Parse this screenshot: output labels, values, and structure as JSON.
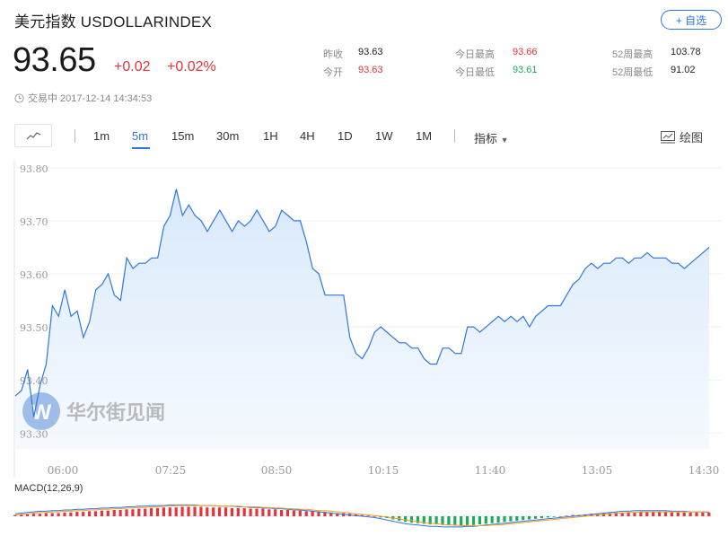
{
  "header": {
    "title": "美元指数 USDOLLARINDEX",
    "follow_label": "+ 自选",
    "price": "93.65",
    "change": "+0.02",
    "change_pct": "+0.02%",
    "status": "交易中 2017-12-14 14:34:53"
  },
  "stats": {
    "prev_close_label": "昨收",
    "prev_close": "93.63",
    "open_label": "今开",
    "open": "93.63",
    "high_label": "今日最高",
    "high": "93.66",
    "low_label": "今日最低",
    "low": "93.61",
    "w52_high_label": "52周最高",
    "w52_high": "103.78",
    "w52_low_label": "52周最低",
    "w52_low": "91.02"
  },
  "toolbar": {
    "intervals": [
      "1m",
      "5m",
      "15m",
      "30m",
      "1H",
      "4H",
      "1D",
      "1W",
      "1M"
    ],
    "active_interval": "5m",
    "indicator_label": "指标",
    "draw_label": "绘图"
  },
  "watermark": {
    "text": "华尔街见闻"
  },
  "colors": {
    "up": "#e8333a",
    "down": "#1bab5b",
    "line": "#2f76e0",
    "accent": "#2f76e0"
  },
  "chart_data": {
    "type": "area",
    "x_ticks": [
      "06:00",
      "07:25",
      "08:50",
      "10:15",
      "11:40",
      "13:05",
      "14:30"
    ],
    "y_ticks": [
      "93.80",
      "93.70",
      "93.60",
      "93.50",
      "93.40",
      "93.30"
    ],
    "ylim": [
      93.27,
      93.815
    ],
    "x": [
      "05:17",
      "05:22",
      "05:27",
      "05:32",
      "05:37",
      "05:42",
      "05:47",
      "05:52",
      "05:57",
      "06:02",
      "06:07",
      "06:12",
      "06:17",
      "06:22",
      "06:27",
      "06:32",
      "06:37",
      "06:42",
      "06:47",
      "06:52",
      "06:57",
      "07:02",
      "07:07",
      "07:12",
      "07:17",
      "07:22",
      "07:27",
      "07:32",
      "07:37",
      "07:42",
      "07:47",
      "07:52",
      "07:57",
      "08:02",
      "08:07",
      "08:12",
      "08:17",
      "08:22",
      "08:27",
      "08:32",
      "08:37",
      "08:42",
      "08:47",
      "08:52",
      "08:57",
      "09:02",
      "09:07",
      "09:12",
      "09:17",
      "09:22",
      "09:27",
      "09:32",
      "09:37",
      "09:42",
      "09:47",
      "09:52",
      "09:57",
      "10:02",
      "10:07",
      "10:12",
      "10:17",
      "10:22",
      "10:27",
      "10:32",
      "10:37",
      "10:42",
      "10:47",
      "10:52",
      "10:57",
      "11:02",
      "11:07",
      "11:12",
      "11:17",
      "11:22",
      "11:27",
      "11:32",
      "11:37",
      "11:42",
      "11:47",
      "11:52",
      "11:57",
      "12:02",
      "12:07",
      "12:12",
      "12:17",
      "12:22",
      "12:27",
      "12:32",
      "12:37",
      "12:42",
      "12:47",
      "12:52",
      "12:57",
      "13:02",
      "13:07",
      "13:12",
      "13:17",
      "13:22",
      "13:27",
      "13:32",
      "13:37",
      "13:42",
      "13:47",
      "13:52",
      "13:57",
      "14:02",
      "14:07",
      "14:12",
      "14:17",
      "14:22",
      "14:27",
      "14:32",
      "14:37"
    ],
    "values": [
      93.37,
      93.38,
      93.42,
      93.33,
      93.39,
      93.43,
      93.54,
      93.52,
      93.57,
      93.52,
      93.53,
      93.48,
      93.51,
      93.57,
      93.58,
      93.6,
      93.56,
      93.55,
      93.63,
      93.61,
      93.62,
      93.62,
      93.63,
      93.63,
      93.69,
      93.71,
      93.76,
      93.71,
      93.73,
      93.71,
      93.7,
      93.68,
      93.7,
      93.72,
      93.7,
      93.68,
      93.7,
      93.69,
      93.7,
      93.72,
      93.7,
      93.68,
      93.69,
      93.72,
      93.71,
      93.7,
      93.7,
      93.66,
      93.61,
      93.6,
      93.56,
      93.56,
      93.56,
      93.56,
      93.48,
      93.45,
      93.44,
      93.46,
      93.49,
      93.5,
      93.49,
      93.48,
      93.47,
      93.47,
      93.46,
      93.46,
      93.44,
      93.43,
      93.43,
      93.46,
      93.46,
      93.45,
      93.45,
      93.5,
      93.5,
      93.49,
      93.5,
      93.51,
      93.52,
      93.51,
      93.52,
      93.51,
      93.52,
      93.5,
      93.52,
      93.53,
      93.54,
      93.54,
      93.54,
      93.56,
      93.58,
      93.59,
      93.61,
      93.62,
      93.61,
      93.62,
      93.62,
      93.63,
      93.63,
      93.62,
      93.63,
      93.63,
      93.64,
      93.63,
      93.63,
      93.63,
      93.62,
      93.62,
      93.61,
      93.62,
      93.63,
      93.64,
      93.65
    ],
    "macd": {
      "label": "MACD(12,26,9)",
      "histogram": [
        0.02,
        0.03,
        0.03,
        0.04,
        0.04,
        0.05,
        0.05,
        0.05,
        0.06,
        0.06,
        0.07,
        0.07,
        0.08,
        0.08,
        0.09,
        0.09,
        0.1,
        0.1,
        0.11,
        0.11,
        0.12,
        0.12,
        0.13,
        0.13,
        0.14,
        0.14,
        0.14,
        0.15,
        0.15,
        0.15,
        0.15,
        0.14,
        0.14,
        0.14,
        0.14,
        0.13,
        0.13,
        0.13,
        0.12,
        0.12,
        0.12,
        0.11,
        0.11,
        0.1,
        0.1,
        0.09,
        0.09,
        0.08,
        0.08,
        0.07,
        0.07,
        0.06,
        0.05,
        0.05,
        0.04,
        0.03,
        0.02,
        0.01,
        0.0,
        -0.02,
        -0.03,
        -0.05,
        -0.07,
        -0.09,
        -0.1,
        -0.11,
        -0.12,
        -0.13,
        -0.13,
        -0.14,
        -0.14,
        -0.15,
        -0.15,
        -0.14,
        -0.14,
        -0.13,
        -0.12,
        -0.11,
        -0.1,
        -0.09,
        -0.08,
        -0.07,
        -0.06,
        -0.05,
        -0.04,
        -0.03,
        -0.02,
        -0.01,
        0.0,
        0.01,
        0.02,
        0.02,
        0.03,
        0.04,
        0.04,
        0.05,
        0.05,
        0.06,
        0.06,
        0.06,
        0.06,
        0.07,
        0.07,
        0.07,
        0.07,
        0.07,
        0.06,
        0.06,
        0.06,
        0.06,
        0.06,
        0.06,
        0.06
      ],
      "dif": [
        0.04,
        0.05,
        0.06,
        0.07,
        0.08,
        0.08,
        0.09,
        0.09,
        0.1,
        0.1,
        0.11,
        0.11,
        0.12,
        0.12,
        0.13,
        0.13,
        0.14,
        0.14,
        0.15,
        0.15,
        0.16,
        0.16,
        0.17,
        0.17,
        0.17,
        0.18,
        0.18,
        0.18,
        0.18,
        0.18,
        0.17,
        0.17,
        0.17,
        0.16,
        0.16,
        0.16,
        0.15,
        0.15,
        0.14,
        0.14,
        0.13,
        0.13,
        0.12,
        0.12,
        0.11,
        0.1,
        0.1,
        0.09,
        0.08,
        0.07,
        0.06,
        0.05,
        0.04,
        0.03,
        0.02,
        0.01,
        0.0,
        -0.01,
        -0.02,
        -0.04,
        -0.06,
        -0.08,
        -0.1,
        -0.12,
        -0.13,
        -0.14,
        -0.15,
        -0.16,
        -0.16,
        -0.17,
        -0.17,
        -0.17,
        -0.17,
        -0.16,
        -0.16,
        -0.15,
        -0.14,
        -0.13,
        -0.12,
        -0.11,
        -0.1,
        -0.09,
        -0.08,
        -0.07,
        -0.06,
        -0.05,
        -0.04,
        -0.03,
        -0.02,
        -0.01,
        0.0,
        0.01,
        0.02,
        0.03,
        0.04,
        0.05,
        0.06,
        0.07,
        0.08,
        0.08,
        0.09,
        0.09,
        0.09,
        0.09,
        0.09,
        0.09,
        0.08,
        0.08,
        0.08,
        0.07,
        0.07,
        0.07,
        0.06
      ],
      "dea": [
        0.02,
        0.03,
        0.04,
        0.05,
        0.06,
        0.06,
        0.07,
        0.07,
        0.08,
        0.08,
        0.09,
        0.09,
        0.1,
        0.1,
        0.11,
        0.11,
        0.12,
        0.12,
        0.13,
        0.13,
        0.14,
        0.14,
        0.15,
        0.15,
        0.16,
        0.16,
        0.17,
        0.17,
        0.17,
        0.17,
        0.17,
        0.17,
        0.17,
        0.16,
        0.16,
        0.16,
        0.16,
        0.15,
        0.15,
        0.15,
        0.14,
        0.14,
        0.13,
        0.13,
        0.12,
        0.12,
        0.11,
        0.11,
        0.1,
        0.09,
        0.09,
        0.08,
        0.07,
        0.06,
        0.05,
        0.04,
        0.03,
        0.02,
        0.01,
        0.0,
        -0.01,
        -0.03,
        -0.04,
        -0.06,
        -0.07,
        -0.09,
        -0.1,
        -0.11,
        -0.12,
        -0.13,
        -0.14,
        -0.14,
        -0.15,
        -0.15,
        -0.15,
        -0.15,
        -0.15,
        -0.14,
        -0.14,
        -0.13,
        -0.12,
        -0.11,
        -0.1,
        -0.09,
        -0.08,
        -0.07,
        -0.06,
        -0.05,
        -0.04,
        -0.03,
        -0.02,
        -0.01,
        0.0,
        0.01,
        0.02,
        0.03,
        0.04,
        0.05,
        0.05,
        0.06,
        0.06,
        0.07,
        0.07,
        0.07,
        0.07,
        0.07,
        0.07,
        0.07,
        0.07,
        0.07,
        0.07,
        0.07,
        0.07
      ]
    }
  }
}
